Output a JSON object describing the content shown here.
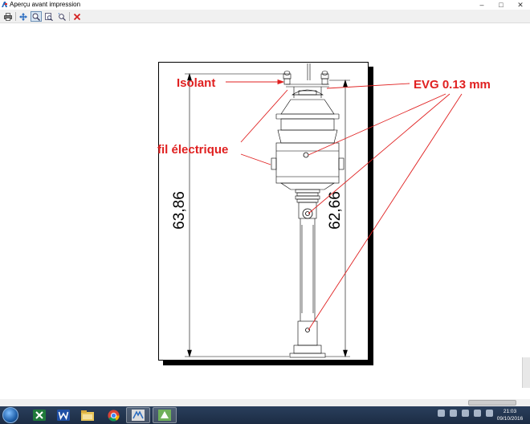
{
  "window": {
    "title": "Aperçu avant impression",
    "minimize": "–",
    "maximize": "□",
    "close": "✕"
  },
  "toolbar": {
    "icons": [
      "printer-icon",
      "move-icon",
      "zoom-window-icon",
      "zoom-extents-icon",
      "zoom-icon",
      "close-preview-icon"
    ]
  },
  "drawing": {
    "dimension_left": "63,86",
    "dimension_right": "62,66",
    "labels": {
      "isolant": "Isolant",
      "fil": "fil électrique",
      "evg": "EVG 0.13 mm"
    },
    "colors": {
      "annotation": "#e02020",
      "line": "#000000"
    }
  },
  "taskbar": {
    "apps": [
      "windows-start",
      "excel-icon",
      "word-icon",
      "file-explorer-icon",
      "chrome-icon",
      "solidworks-icon",
      "app-icon"
    ],
    "clock_time": "21:03",
    "clock_date": "09/10/2016"
  }
}
